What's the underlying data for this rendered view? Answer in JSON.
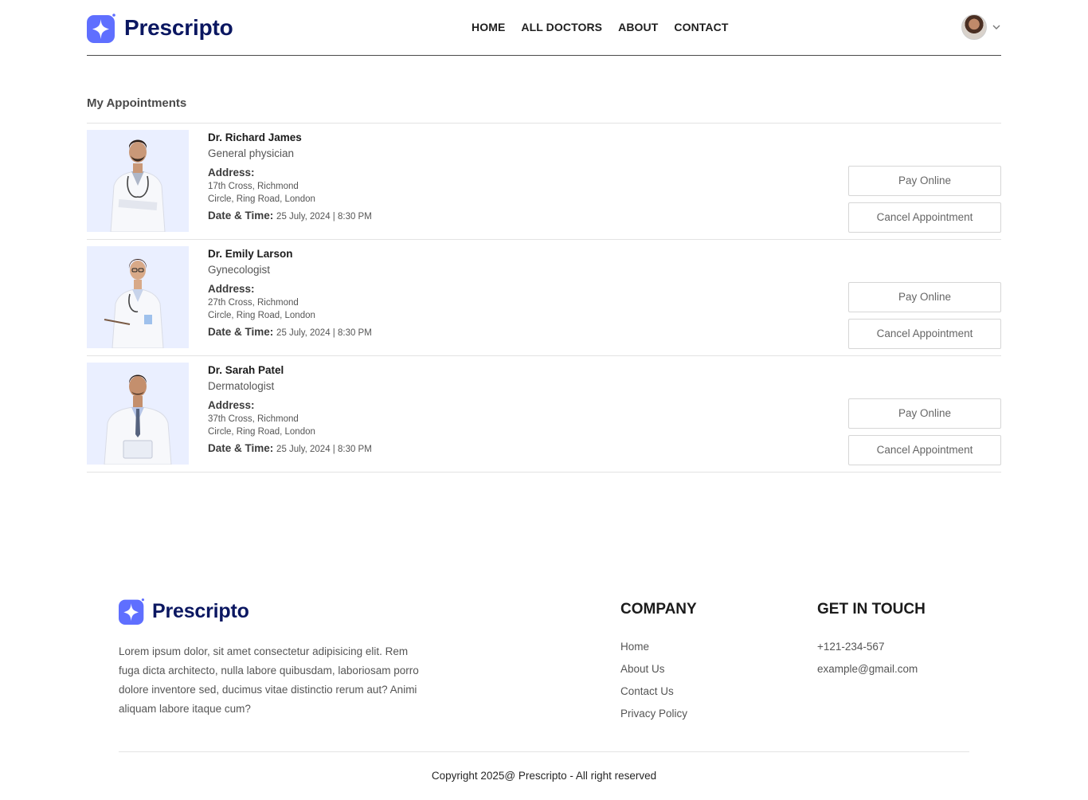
{
  "brand": {
    "name": "Prescripto",
    "accent": "#5f6fff",
    "dark": "#0b1761"
  },
  "nav": {
    "items": [
      {
        "label": "HOME"
      },
      {
        "label": "ALL DOCTORS"
      },
      {
        "label": "ABOUT"
      },
      {
        "label": "CONTACT"
      }
    ]
  },
  "page": {
    "title": "My Appointments"
  },
  "appointments": [
    {
      "name": "Dr. Richard James",
      "speciality": "General physician",
      "address_label": "Address:",
      "address_line1": "17th Cross, Richmond",
      "address_line2": "Circle, Ring Road, London",
      "datetime_label": "Date & Time:",
      "datetime": "25 July, 2024 | 8:30 PM",
      "pay_label": "Pay Online",
      "cancel_label": "Cancel Appointment"
    },
    {
      "name": "Dr. Emily Larson",
      "speciality": "Gynecologist",
      "address_label": "Address:",
      "address_line1": "27th Cross, Richmond",
      "address_line2": "Circle, Ring Road, London",
      "datetime_label": "Date & Time:",
      "datetime": "25 July, 2024 | 8:30 PM",
      "pay_label": "Pay Online",
      "cancel_label": "Cancel Appointment"
    },
    {
      "name": "Dr. Sarah Patel",
      "speciality": "Dermatologist",
      "address_label": "Address:",
      "address_line1": "37th Cross, Richmond",
      "address_line2": "Circle, Ring Road, London",
      "datetime_label": "Date & Time:",
      "datetime": "25 July, 2024 | 8:30 PM",
      "pay_label": "Pay Online",
      "cancel_label": "Cancel Appointment"
    }
  ],
  "footer": {
    "description": "Lorem ipsum dolor, sit amet consectetur adipisicing elit. Rem fuga dicta architecto, nulla labore quibusdam, laboriosam porro dolore inventore sed, ducimus vitae distinctio rerum aut? Animi aliquam labore itaque cum?",
    "company": {
      "title": "COMPANY",
      "links": [
        "Home",
        "About Us",
        "Contact Us",
        "Privacy Policy"
      ]
    },
    "touch": {
      "title": "GET IN TOUCH",
      "phone": "+121-234-567",
      "email": "example@gmail.com"
    },
    "copyright": "Copyright 2025@ Prescripto - All right reserved"
  }
}
